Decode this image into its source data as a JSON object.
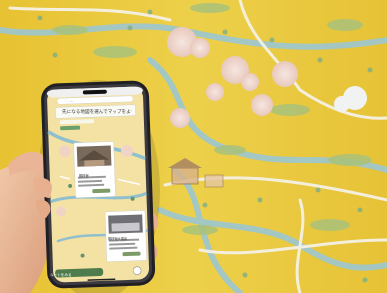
{
  "phone": {
    "url_text": "…",
    "banner_text": "先になる地図を選んでマップをよう",
    "card1_title": "藤枝宿",
    "card2_title": "藤枝宿大橋臺",
    "bottom_button": "ルートをみる"
  },
  "colors": {
    "map_yellow": "#e9c93a",
    "river_blue": "#8fc3cf",
    "cherry_pink": "#efd2c8",
    "phone_frame": "#1f1f24"
  }
}
